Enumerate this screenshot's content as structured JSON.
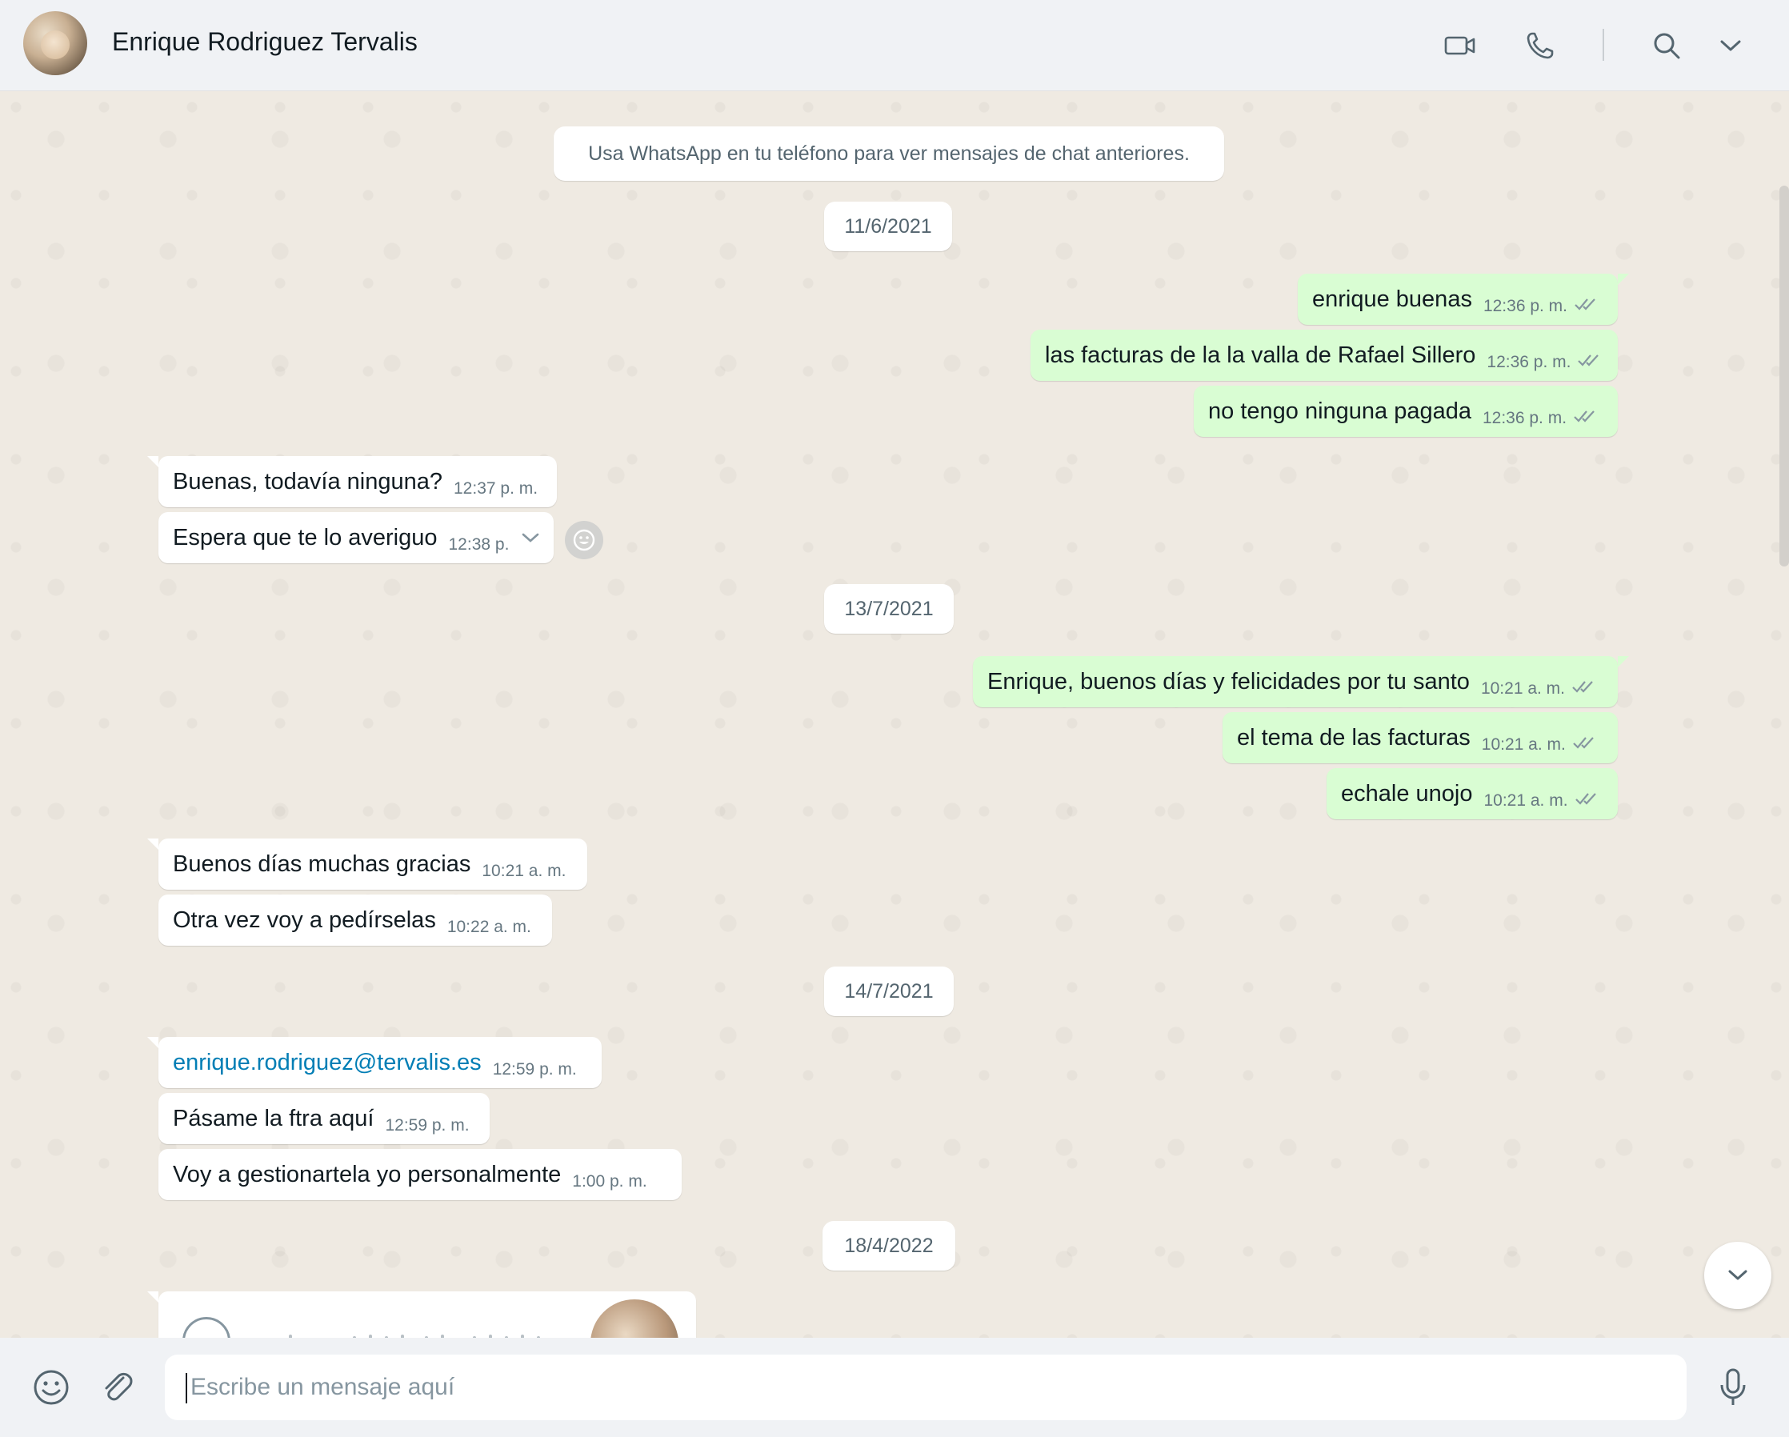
{
  "header": {
    "contact_name": "Enrique Rodriguez Tervalis",
    "icons": [
      "video-call-icon",
      "voice-call-icon",
      "search-icon",
      "menu-chevron-icon"
    ]
  },
  "chat": {
    "system_notice": "Usa WhatsApp en tu teléfono para ver mensajes de chat anteriores.",
    "dates": [
      "11/6/2021",
      "13/7/2021",
      "14/7/2021",
      "18/4/2022"
    ],
    "messages": [
      {
        "dir": "out",
        "text": "enrique buenas",
        "time": "12:36 p. m.",
        "status": "read"
      },
      {
        "dir": "out",
        "text": "las facturas de la la valla de Rafael Sillero",
        "time": "12:36 p. m.",
        "status": "read"
      },
      {
        "dir": "out",
        "text": "no tengo ninguna pagada",
        "time": "12:36 p. m.",
        "status": "read"
      },
      {
        "dir": "in",
        "text": "Buenas, todavía ninguna?",
        "time": "12:37 p. m."
      },
      {
        "dir": "in",
        "text": "Espera que te lo averiguo",
        "time": "12:38 p."
      },
      {
        "dir": "out",
        "text": "Enrique, buenos días y felicidades por tu santo",
        "time": "10:21 a. m.",
        "status": "read"
      },
      {
        "dir": "out",
        "text": "el tema de las facturas",
        "time": "10:21 a. m.",
        "status": "read"
      },
      {
        "dir": "out",
        "text": "echale unojo",
        "time": "10:21 a. m.",
        "status": "read"
      },
      {
        "dir": "in",
        "text": "Buenos días muchas gracias",
        "time": "10:21 a. m."
      },
      {
        "dir": "in",
        "text": "Otra vez voy a pedírselas",
        "time": "10:22 a. m."
      },
      {
        "dir": "in",
        "text": "enrique.rodriguez@tervalis.es",
        "time": "12:59 p. m.",
        "is_link": true
      },
      {
        "dir": "in",
        "text": "Pásame la ftra aquí",
        "time": "12:59 p. m."
      },
      {
        "dir": "in",
        "text": "Voy a gestionartela yo personalmente",
        "time": "1:00 p. m."
      }
    ]
  },
  "composer": {
    "placeholder": "Escribe un mensaje aquí",
    "icons": [
      "emoji-icon",
      "attach-icon",
      "microphone-icon"
    ]
  },
  "colors": {
    "chat_bg": "#efeae2",
    "outgoing_bubble": "#d9fdd3",
    "incoming_bubble": "#ffffff",
    "read_ticks": "#8696a0",
    "link": "#027eb5",
    "header_bg": "#f0f2f5"
  }
}
